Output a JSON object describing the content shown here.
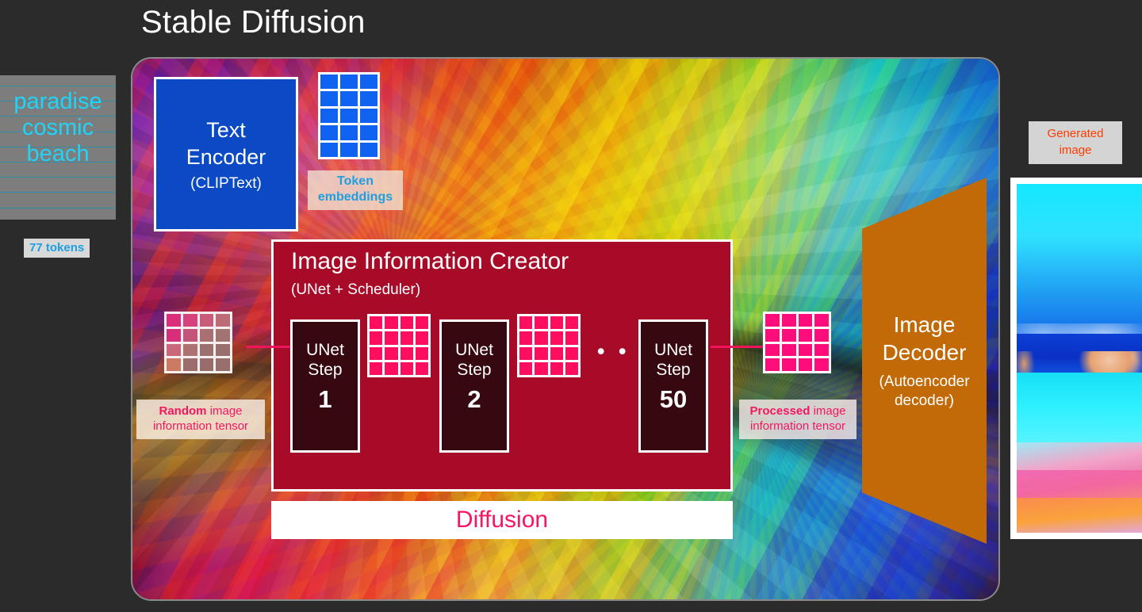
{
  "title": "Stable Diffusion",
  "prompt": {
    "lines": [
      "paradise",
      "cosmic",
      "beach"
    ],
    "tokens_badge": "77 tokens",
    "rule_count": 10
  },
  "text_encoder": {
    "name": "Text",
    "name2": "Encoder",
    "subtitle": "(CLIPText)",
    "color": "#0b4ac4"
  },
  "token_embeddings": {
    "label_line1": "Token",
    "label_line2": "embeddings",
    "cols": 3,
    "rows": 5,
    "cell_color": "#1062f0",
    "label_color": "#1e9fe0"
  },
  "image_information_creator": {
    "title": "Image Information Creator",
    "subtitle": "(UNet + Scheduler)",
    "color": "#a80b28",
    "steps": [
      {
        "word1": "UNet",
        "word2": "Step",
        "number": "1"
      },
      {
        "word1": "UNet",
        "word2": "Step",
        "number": "2"
      },
      {
        "word1": "UNet",
        "word2": "Step",
        "number": "50"
      }
    ],
    "ellipsis": "• • •",
    "latent_cell_color": "#ff0d5e",
    "latent_cols": 4,
    "latent_rows": 4
  },
  "diffusion_bar": {
    "label": "Diffusion",
    "text_color": "#f5165f",
    "bg_color": "#ffffff"
  },
  "random_tensor": {
    "label_bold": "Random",
    "label_rest": " image information tensor",
    "cols": 4,
    "rows": 4,
    "text_color": "#f5165f"
  },
  "processed_tensor": {
    "label_bold": "Processed",
    "label_rest": " image information tensor",
    "cols": 4,
    "rows": 4,
    "cell_color": "#ff0d7a",
    "text_color": "#f5165f"
  },
  "image_decoder": {
    "name": "Image",
    "name2": "Decoder",
    "subtitle1": "(Autoencoder",
    "subtitle2": "decoder)",
    "color": "#c26a07"
  },
  "generated_image": {
    "badge_line1": "Generated",
    "badge_line2": "image",
    "badge_text_color": "#ff3b00",
    "badge_bg_color": "#d4d4d4",
    "description": "psychedelic cyan sky, blue ocean, rock stacks, pink and orange beach"
  },
  "arrows": {
    "color": "#f0145e"
  },
  "background": {
    "page_color": "#2b2b2b",
    "panel_description": "false-color psychedelic close-up of an eye"
  }
}
